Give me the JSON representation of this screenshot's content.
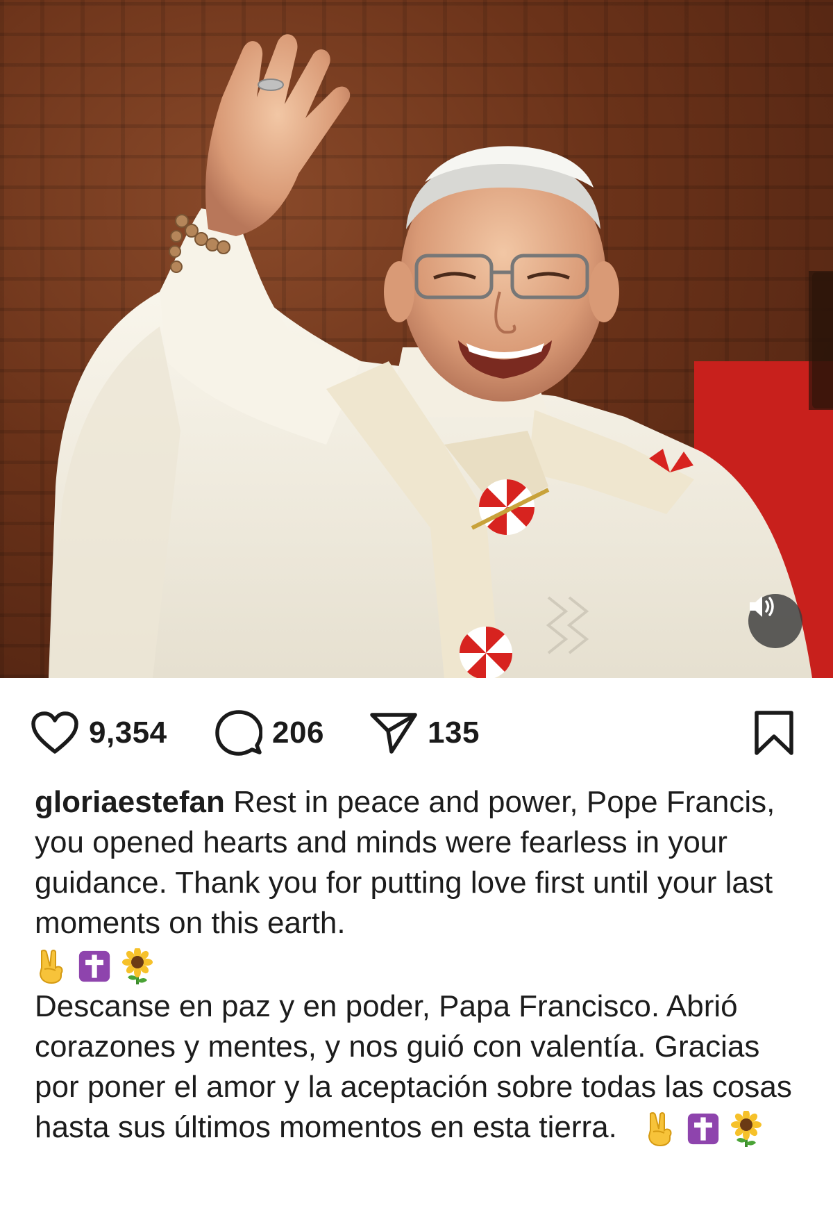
{
  "post": {
    "username": "gloriaestefan",
    "caption_en": "Rest in peace and power, Pope Francis, you opened hearts and minds were fearless in your guidance. Thank you for putting love first until your last moments on this earth.",
    "caption_es": "Descanse en paz y en poder, Papa Francisco. Abrió corazones y mentes, y nos guió con valentía. Gracias por poner el amor y la aceptación sobre todas las cosas hasta sus últimos momentos en esta tierra."
  },
  "stats": {
    "likes": "9,354",
    "comments": "206",
    "shares": "135"
  },
  "icons": {
    "like": "heart-icon",
    "comment": "comment-bubble-icon",
    "share": "paper-plane-icon",
    "save": "bookmark-icon",
    "audio": "speaker-icon",
    "emoji": [
      "victory-hand-emoji",
      "latin-cross-emoji",
      "sunflower-emoji"
    ]
  },
  "colors": {
    "background": "#ffffff",
    "text": "#1c1c1c",
    "icon": "#1a1a1a",
    "emoji_cross_bg": "#8e44ad",
    "vestment": "#f3efe4",
    "accent_red": "#d7231f"
  }
}
